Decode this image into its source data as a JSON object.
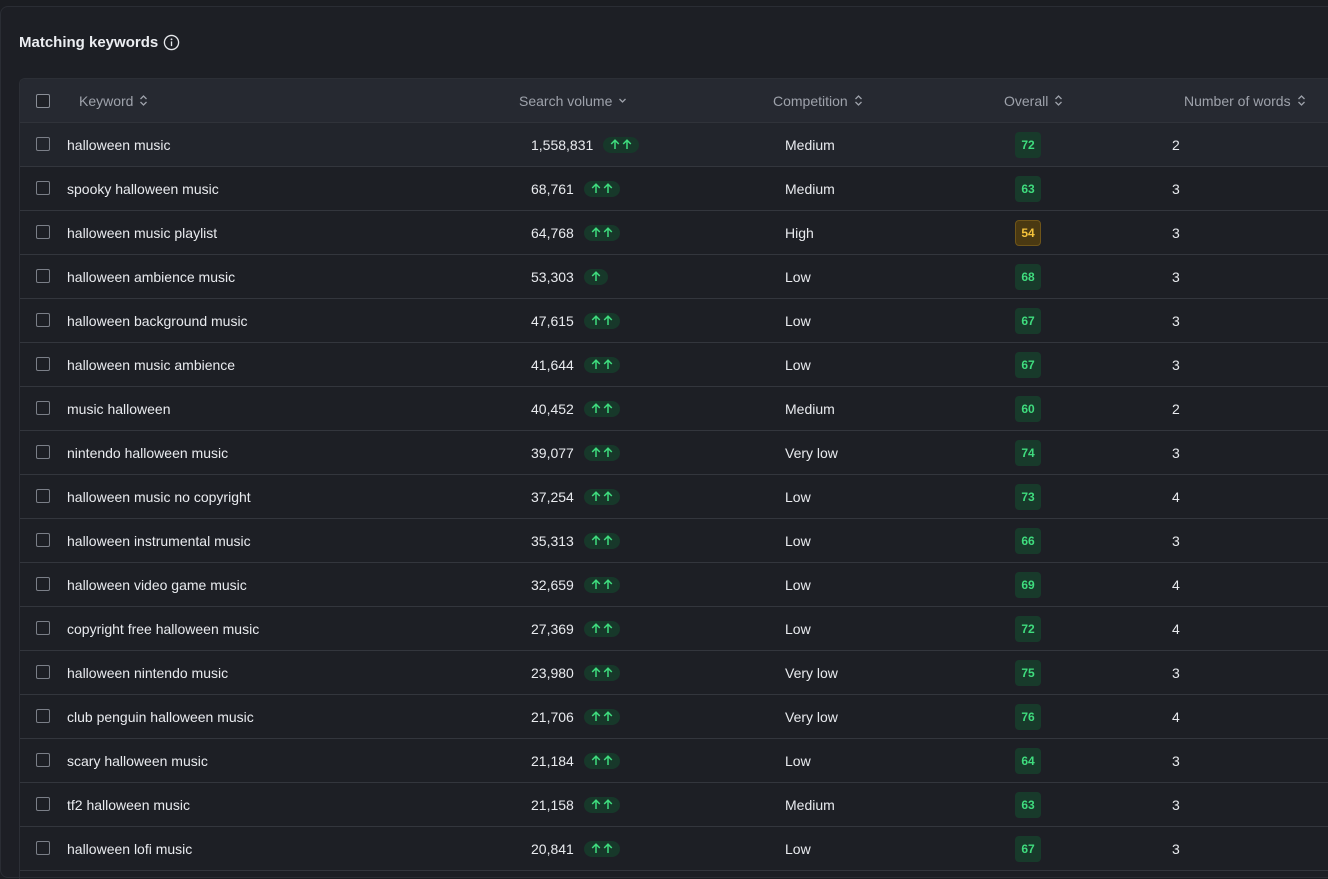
{
  "section": {
    "title": "Matching keywords",
    "info_icon": "info-circle-icon"
  },
  "colors": {
    "background": "#1b1d22",
    "header_bg": "#262931",
    "score_green": "#3fdc7e",
    "score_green_bg": "#183a2b",
    "score_yellow": "#f5c33b",
    "score_yellow_bg": "#4a3912",
    "trend_arrow": "#3fdc7e"
  },
  "table": {
    "columns": [
      {
        "label": "Keyword",
        "sort_icon": "sort-updown-icon"
      },
      {
        "label": "Search volume",
        "sort_icon": "chevron-down-icon"
      },
      {
        "label": "Competition",
        "sort_icon": "sort-updown-icon"
      },
      {
        "label": "Overall",
        "sort_icon": "sort-updown-icon"
      },
      {
        "label": "Number of words",
        "sort_icon": "sort-updown-icon"
      }
    ],
    "rows": [
      {
        "keyword": "halloween music",
        "volume": "1,558,831",
        "trend": 2,
        "competition": "Medium",
        "overall": "72",
        "level": "good",
        "words": "2"
      },
      {
        "keyword": "spooky halloween music",
        "volume": "68,761",
        "trend": 2,
        "competition": "Medium",
        "overall": "63",
        "level": "good",
        "words": "3"
      },
      {
        "keyword": "halloween music playlist",
        "volume": "64,768",
        "trend": 2,
        "competition": "High",
        "overall": "54",
        "level": "warn",
        "words": "3"
      },
      {
        "keyword": "halloween ambience music",
        "volume": "53,303",
        "trend": 1,
        "competition": "Low",
        "overall": "68",
        "level": "good",
        "words": "3"
      },
      {
        "keyword": "halloween background music",
        "volume": "47,615",
        "trend": 2,
        "competition": "Low",
        "overall": "67",
        "level": "good",
        "words": "3"
      },
      {
        "keyword": "halloween music ambience",
        "volume": "41,644",
        "trend": 2,
        "competition": "Low",
        "overall": "67",
        "level": "good",
        "words": "3"
      },
      {
        "keyword": "music halloween",
        "volume": "40,452",
        "trend": 2,
        "competition": "Medium",
        "overall": "60",
        "level": "good",
        "words": "2"
      },
      {
        "keyword": "nintendo halloween music",
        "volume": "39,077",
        "trend": 2,
        "competition": "Very low",
        "overall": "74",
        "level": "good",
        "words": "3"
      },
      {
        "keyword": "halloween music no copyright",
        "volume": "37,254",
        "trend": 2,
        "competition": "Low",
        "overall": "73",
        "level": "good",
        "words": "4"
      },
      {
        "keyword": "halloween instrumental music",
        "volume": "35,313",
        "trend": 2,
        "competition": "Low",
        "overall": "66",
        "level": "good",
        "words": "3"
      },
      {
        "keyword": "halloween video game music",
        "volume": "32,659",
        "trend": 2,
        "competition": "Low",
        "overall": "69",
        "level": "good",
        "words": "4"
      },
      {
        "keyword": "copyright free halloween music",
        "volume": "27,369",
        "trend": 2,
        "competition": "Low",
        "overall": "72",
        "level": "good",
        "words": "4"
      },
      {
        "keyword": "halloween nintendo music",
        "volume": "23,980",
        "trend": 2,
        "competition": "Very low",
        "overall": "75",
        "level": "good",
        "words": "3"
      },
      {
        "keyword": "club penguin halloween music",
        "volume": "21,706",
        "trend": 2,
        "competition": "Very low",
        "overall": "76",
        "level": "good",
        "words": "4"
      },
      {
        "keyword": "scary halloween music",
        "volume": "21,184",
        "trend": 2,
        "competition": "Low",
        "overall": "64",
        "level": "good",
        "words": "3"
      },
      {
        "keyword": "tf2 halloween music",
        "volume": "21,158",
        "trend": 2,
        "competition": "Medium",
        "overall": "63",
        "level": "good",
        "words": "3"
      },
      {
        "keyword": "halloween lofi music",
        "volume": "20,841",
        "trend": 2,
        "competition": "Low",
        "overall": "67",
        "level": "good",
        "words": "3"
      }
    ]
  }
}
